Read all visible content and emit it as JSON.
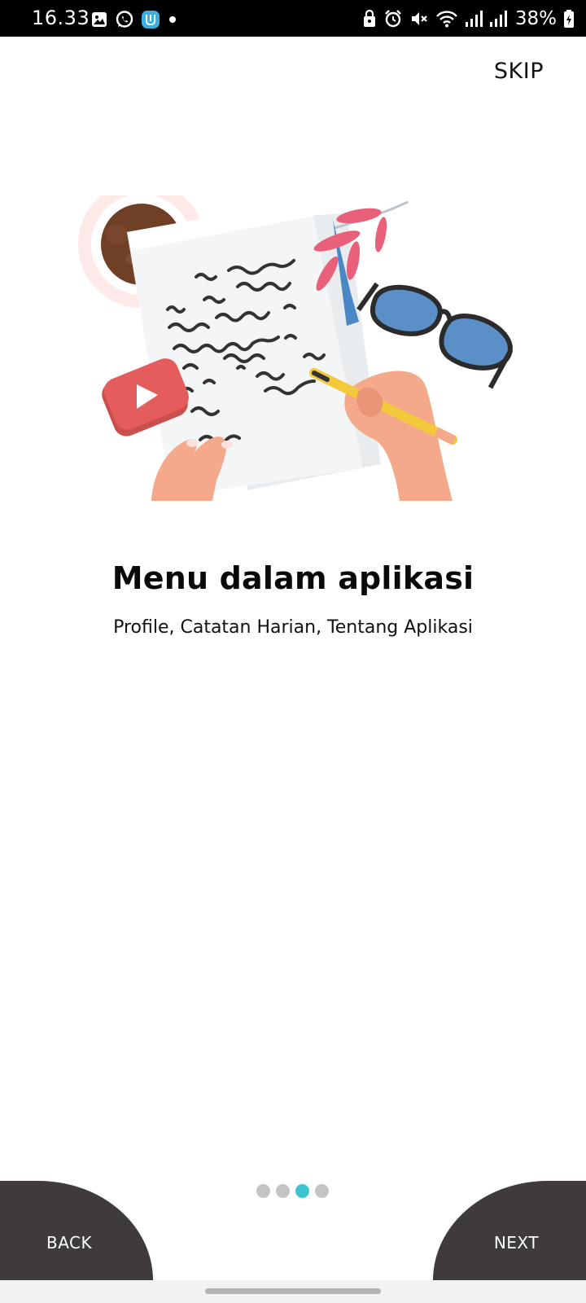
{
  "status_bar": {
    "time": "16.33",
    "battery": "38%",
    "left_icons": [
      "gallery-icon",
      "whatsapp-icon",
      "app-notification-icon",
      "dot-icon"
    ],
    "right_icons": [
      "lock-icon",
      "alarm-icon",
      "mute-icon",
      "wifi-icon",
      "signal-icon",
      "signal-icon",
      "battery-charging-icon"
    ]
  },
  "header": {
    "skip_label": "SKIP"
  },
  "onboarding": {
    "illustration": "writing-notes-illustration",
    "title": "Menu dalam aplikasi",
    "subtitle": "Profile, Catatan Harian, Tentang Aplikasi",
    "page_indicator": {
      "total": 4,
      "current": 3
    }
  },
  "footer": {
    "back_label": "BACK",
    "next_label": "NEXT"
  },
  "colors": {
    "accent": "#3ec3cf",
    "dot_inactive": "#c4c4c4",
    "nav_button": "#3f3b3a",
    "status_bar": "#000000"
  }
}
